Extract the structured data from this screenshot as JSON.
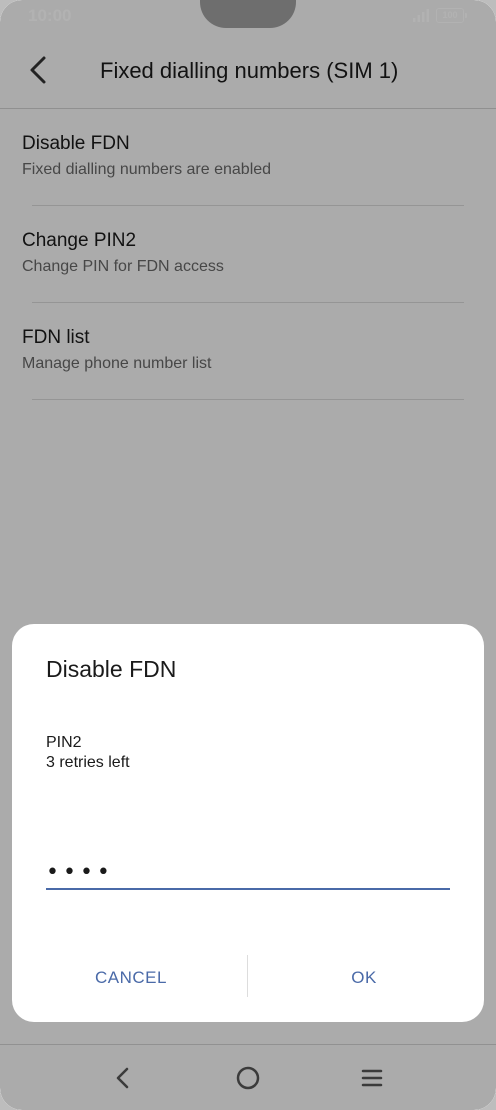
{
  "status_bar": {
    "time": "10:00",
    "battery": "100"
  },
  "header": {
    "title": "Fixed dialling numbers (SIM 1)",
    "back_icon": "chevron-left-icon"
  },
  "list": {
    "items": [
      {
        "title": "Disable FDN",
        "subtitle": "Fixed dialling numbers are enabled"
      },
      {
        "title": "Change PIN2",
        "subtitle": "Change PIN for FDN access"
      },
      {
        "title": "FDN list",
        "subtitle": "Manage phone number list"
      }
    ]
  },
  "dialog": {
    "title": "Disable FDN",
    "pin_label": "PIN2",
    "retries": "3 retries left",
    "pin_value": "1234",
    "cancel_label": "CANCEL",
    "ok_label": "OK"
  },
  "colors": {
    "accent": "#4a6aa8",
    "background": "#f5f5f5",
    "dialog": "#ffffff"
  },
  "nav_icons": [
    "back-icon",
    "home-icon",
    "menu-icon"
  ]
}
